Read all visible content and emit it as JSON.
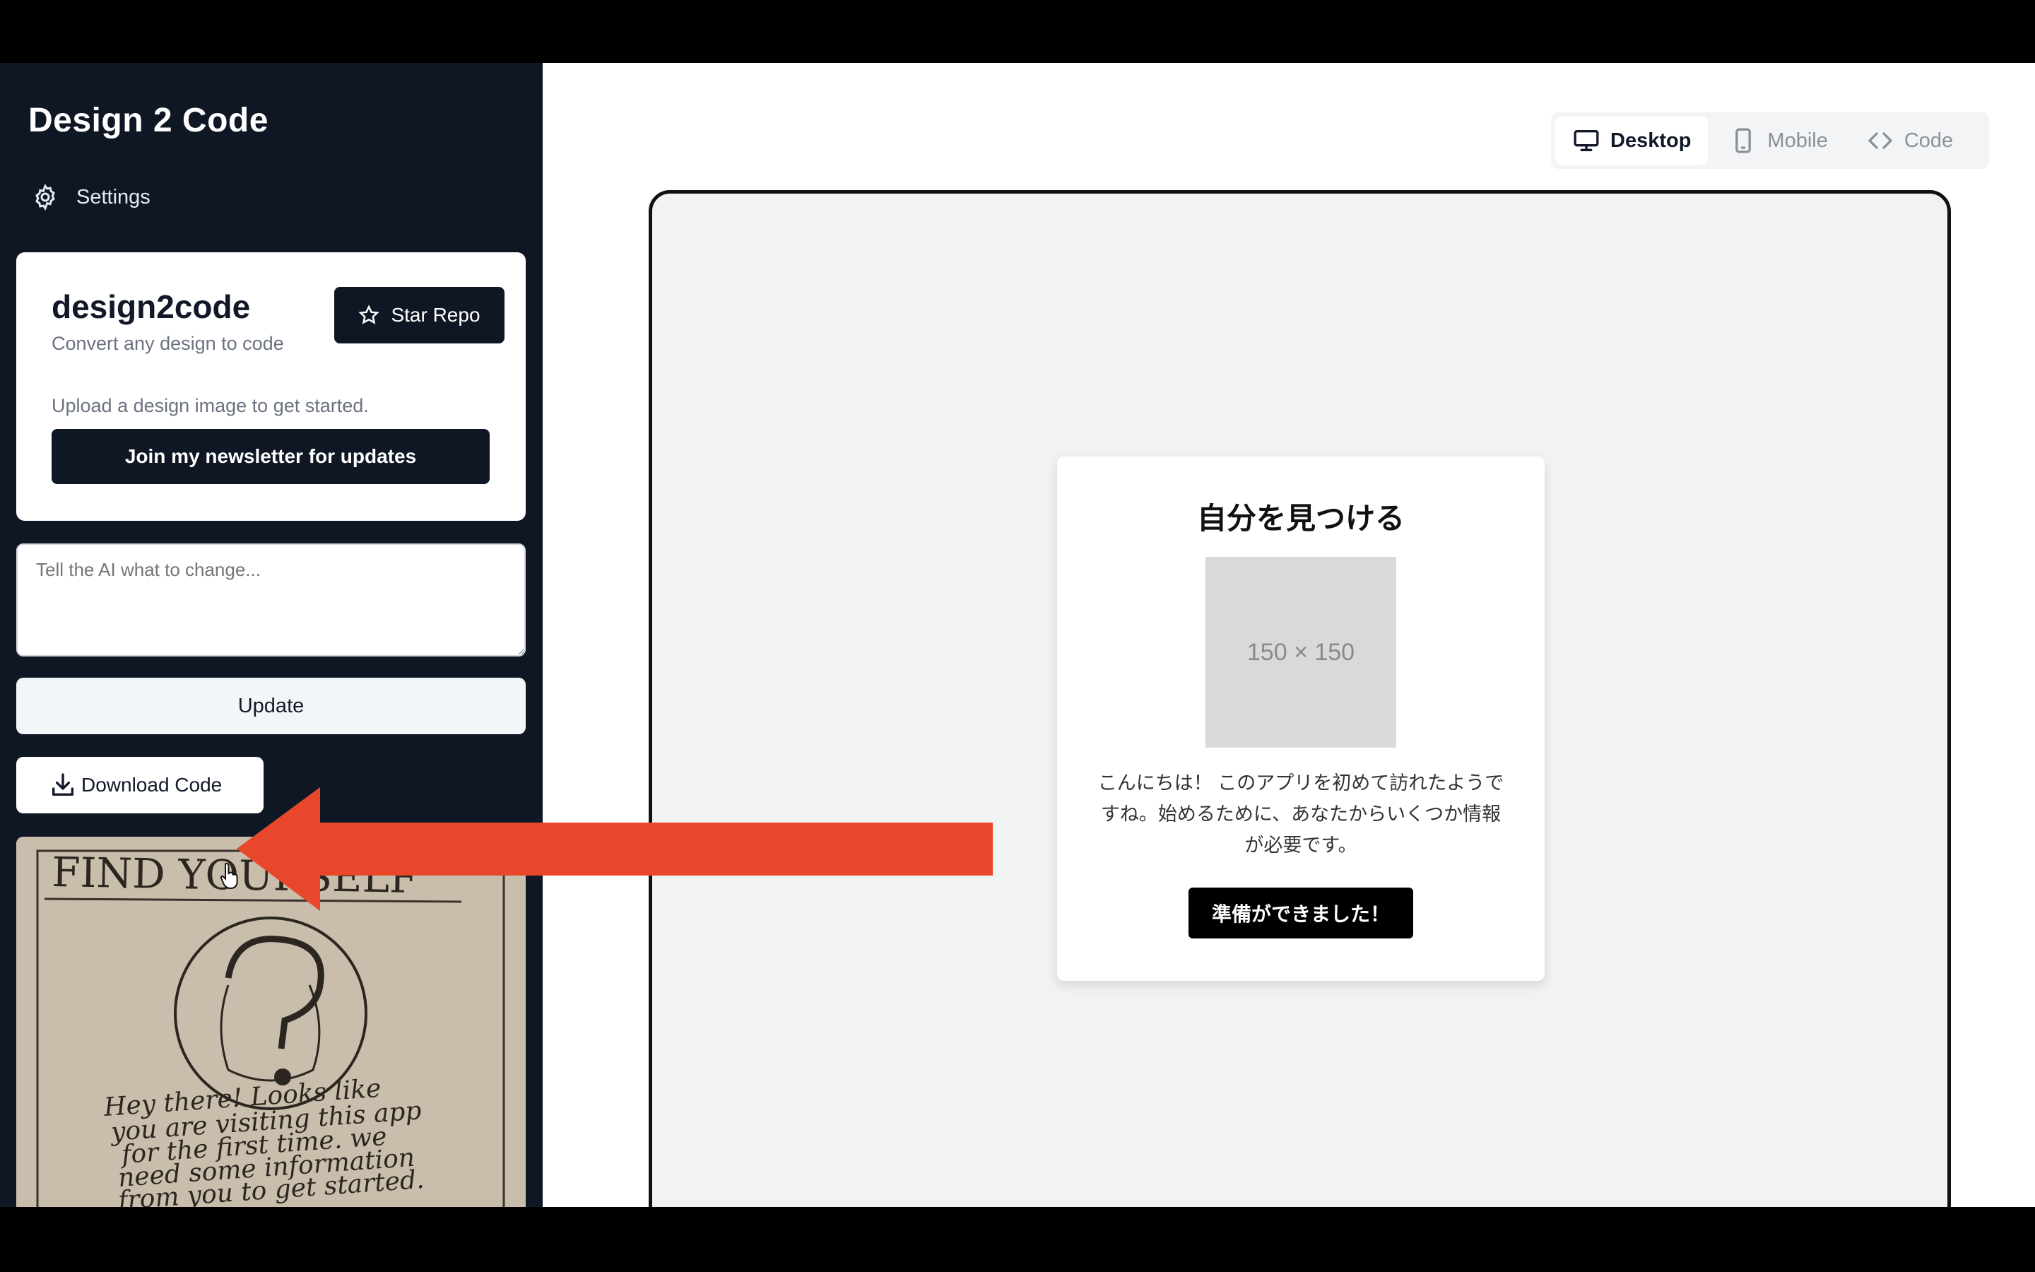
{
  "sidebar": {
    "app_title": "Design 2 Code",
    "settings_label": "Settings",
    "card": {
      "title": "design2code",
      "subtitle": "Convert any design to code",
      "star_label": "Star Repo",
      "note": "Upload a design image to get started.",
      "newsletter_label": "Join my newsletter for updates"
    },
    "prompt_placeholder": "Tell the AI what to change...",
    "update_label": "Update",
    "download_label": "Download Code",
    "sketch": {
      "title": "FIND YOURSELF",
      "lines": [
        "Hey there! Looks like",
        "you are visiting this app",
        "for the first time. we",
        "need some information",
        "from you to get started."
      ]
    }
  },
  "view_toggle": {
    "desktop": "Desktop",
    "mobile": "Mobile",
    "code": "Code",
    "active": "desktop"
  },
  "preview": {
    "title": "自分を見つける",
    "image_placeholder": "150 × 150",
    "text": "こんにちは！ このアプリを初めて訪れたようですね。始めるために、あなたからいくつか情報が必要です。",
    "button_label": "準備ができました！"
  },
  "colors": {
    "sidebar_bg": "#0f1724",
    "arrow": "#e8472b"
  }
}
